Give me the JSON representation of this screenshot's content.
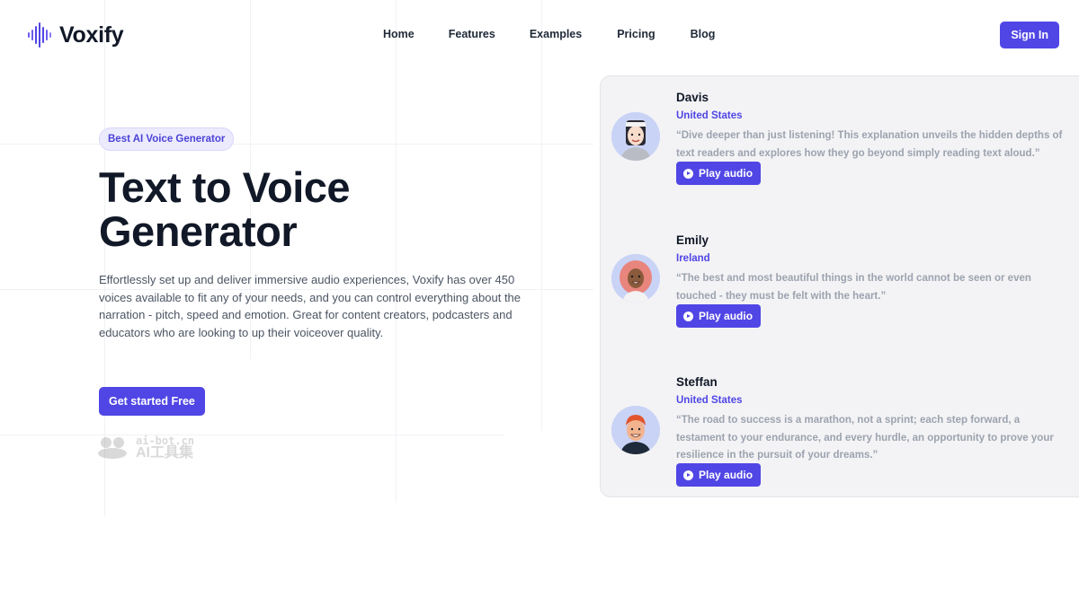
{
  "brand": {
    "name": "Voxify",
    "accent": "#5046e5"
  },
  "nav": {
    "items": [
      {
        "label": "Home"
      },
      {
        "label": "Features"
      },
      {
        "label": "Examples"
      },
      {
        "label": "Pricing"
      },
      {
        "label": "Blog"
      }
    ],
    "signin_label": "Sign In"
  },
  "hero": {
    "badge": "Best AI Voice Generator",
    "title": "Text to Voice Generator",
    "description": "Effortlessly set up and deliver immersive audio experiences, Voxify has over 450 voices available to fit any of your needs, and you can control everything about the narration - pitch, speed and emotion. Great for content creators, podcasters and educators who are looking to up their voiceover quality.",
    "cta_label": "Get started Free"
  },
  "watermark": {
    "top": "ai-bot.cn",
    "bottom": "AI工具集"
  },
  "voices": [
    {
      "name": "Davis",
      "country": "United States",
      "quote": "“Dive deeper than just listening! This explanation unveils the hidden depths of text readers and explores how they go beyond simply reading text aloud.”",
      "play_label": "Play audio",
      "avatar_icon": "avatar-davis-icon"
    },
    {
      "name": "Emily",
      "country": "Ireland",
      "quote": "“The best and most beautiful things in the world cannot be seen or even touched - they must be felt with the heart.”",
      "play_label": "Play audio",
      "avatar_icon": "avatar-emily-icon"
    },
    {
      "name": "Steffan",
      "country": "United States",
      "quote": "“The road to success is a marathon, not a sprint; each step forward, a testament to your endurance, and every hurdle, an opportunity to prove your resilience in the pursuit of your dreams.”",
      "play_label": "Play audio",
      "avatar_icon": "avatar-steffan-icon"
    }
  ]
}
